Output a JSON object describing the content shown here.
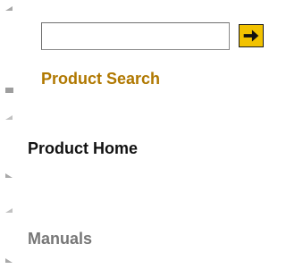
{
  "search": {
    "value": "",
    "placeholder": "",
    "go_button_icon": "arrow-right-icon"
  },
  "nav": {
    "product_search": {
      "label": "Product Search",
      "color": "#b07800"
    },
    "product_home": {
      "label": "Product Home",
      "color": "#111111"
    },
    "manuals": {
      "label": "Manuals",
      "color": "#777777"
    }
  },
  "colors": {
    "go_button_bg": "#f2c200",
    "go_button_arrow": "#111111"
  }
}
